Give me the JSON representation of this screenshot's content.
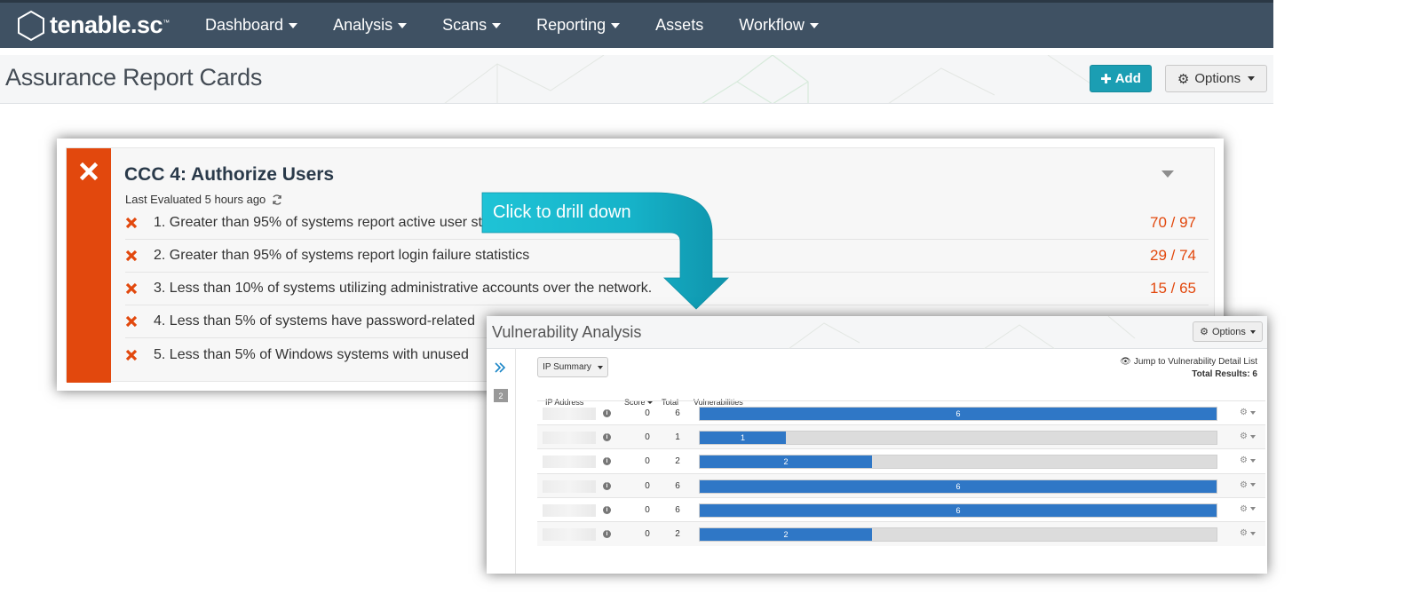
{
  "brand": {
    "name": "tenable.sc",
    "tm": "™"
  },
  "nav": {
    "items": [
      {
        "label": "Dashboard",
        "dropdown": true
      },
      {
        "label": "Analysis",
        "dropdown": true
      },
      {
        "label": "Scans",
        "dropdown": true
      },
      {
        "label": "Reporting",
        "dropdown": true
      },
      {
        "label": "Assets",
        "dropdown": false
      },
      {
        "label": "Workflow",
        "dropdown": true
      }
    ]
  },
  "page": {
    "title": "Assurance Report Cards",
    "add_label": "Add",
    "options_label": "Options"
  },
  "card": {
    "title": "CCC 4: Authorize Users",
    "last_evaluated": "Last Evaluated 5 hours ago",
    "status": "fail",
    "criteria": [
      {
        "text": "1. Greater than 95% of systems report active user statistics.",
        "score": "70 / 97"
      },
      {
        "text": "2. Greater than 95% of systems report login failure statistics",
        "score": "29 / 74"
      },
      {
        "text": "3. Less than 10% of systems utilizing administrative accounts over the network.",
        "score": "15 / 65"
      },
      {
        "text": "4. Less than 5% of systems have password-related",
        "score": ""
      },
      {
        "text": "5. Less than 5% of Windows systems with unused",
        "score": ""
      }
    ]
  },
  "callout": {
    "text": "Click to drill down",
    "color": "#19bcd0"
  },
  "vuln": {
    "title": "Vulnerability Analysis",
    "options_label": "Options",
    "tool": "IP Summary",
    "jump_link": "Jump to Vulnerability Detail List",
    "total_results": "Total Results: 6",
    "page_badge": "2",
    "columns": {
      "ip": "IP Address",
      "score": "Score",
      "total": "Total",
      "vulns": "Vulnerabilities"
    },
    "rows": [
      {
        "score": "0",
        "total": "6",
        "bar_value": 6,
        "bar_max": 6
      },
      {
        "score": "0",
        "total": "1",
        "bar_value": 1,
        "bar_max": 6
      },
      {
        "score": "0",
        "total": "2",
        "bar_value": 2,
        "bar_max": 6
      },
      {
        "score": "0",
        "total": "6",
        "bar_value": 6,
        "bar_max": 6
      },
      {
        "score": "0",
        "total": "6",
        "bar_value": 6,
        "bar_max": 6
      },
      {
        "score": "0",
        "total": "2",
        "bar_value": 2,
        "bar_max": 6
      }
    ]
  },
  "colors": {
    "nav_bg": "#3f5163",
    "fail": "#e2480d",
    "add_button": "#1b9eb3",
    "bar_fill": "#2f77c6",
    "callout": "#19bcd0"
  }
}
